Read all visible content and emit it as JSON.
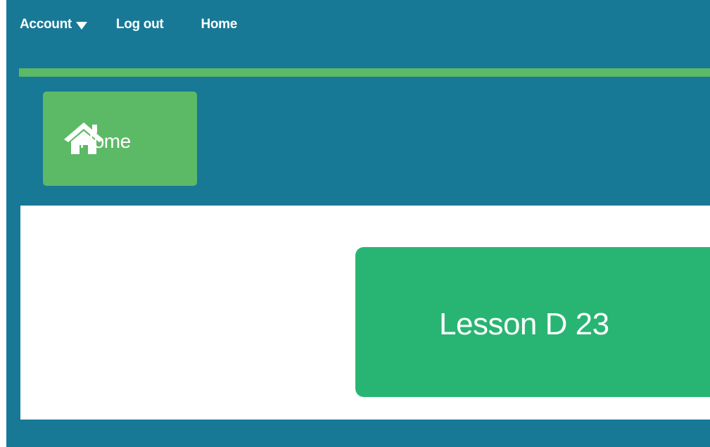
{
  "nav": {
    "account_label": "Account",
    "logout_label": "Log out",
    "home_label": "Home"
  },
  "home_tile": {
    "label": "Home",
    "icon": "home-icon"
  },
  "lesson": {
    "label": "Lesson D 23"
  },
  "colors": {
    "frame": "#177996",
    "accent_green": "#5cb965",
    "lesson_green": "#28b573",
    "content_bg": "#ffffff"
  }
}
